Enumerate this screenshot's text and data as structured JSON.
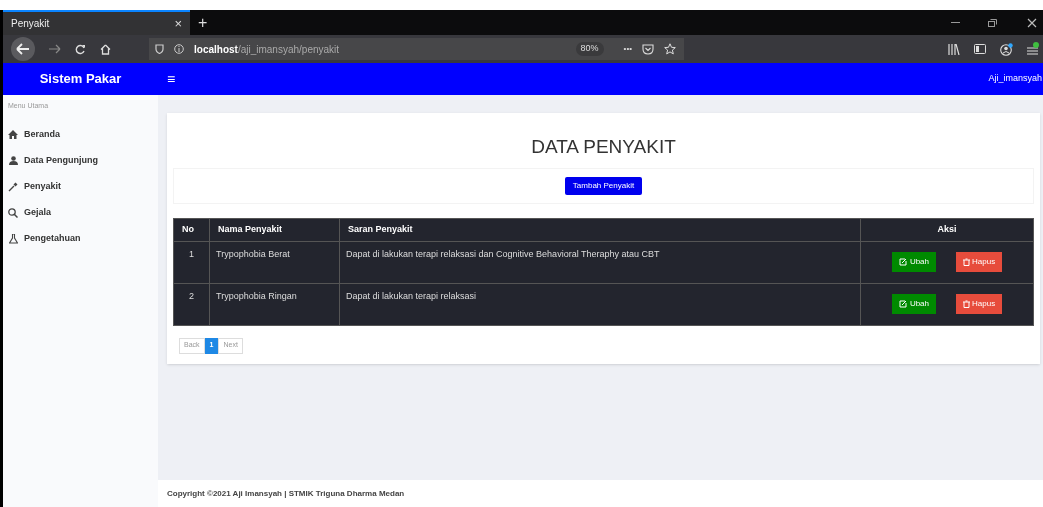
{
  "browser": {
    "tab_title": "Penyakit",
    "tab_close": "×",
    "new_tab": "+",
    "url": "**localhost**/aji_imansyah/penyakit",
    "zoom": "80%",
    "more": "•••"
  },
  "header": {
    "brand": "Sistem Pakar",
    "menu_toggle": "≡",
    "user": "Aji_imansyah"
  },
  "sidebar": {
    "heading": "Menu Utama",
    "items": [
      {
        "label": "Beranda"
      },
      {
        "label": "Data Pengunjung"
      },
      {
        "label": "Penyakit"
      },
      {
        "label": "Gejala"
      },
      {
        "label": "Pengetahuan"
      }
    ]
  },
  "page": {
    "title": "DATA PENYAKIT",
    "add_button": "Tambah Penyakit"
  },
  "table": {
    "columns": [
      "No",
      "Nama Penyakit",
      "Saran Penyakit",
      "Aksi"
    ],
    "rows": [
      {
        "no": "1",
        "name": "Trypophobia Berat",
        "advice": "Dapat di lakukan terapi relaksasi dan Cognitive Behavioral Theraphy atau CBT",
        "edit": "Ubah",
        "delete": "Hapus"
      },
      {
        "no": "2",
        "name": "Trypophobia Ringan",
        "advice": "Dapat di lakukan terapi relaksasi",
        "edit": "Ubah",
        "delete": "Hapus"
      }
    ]
  },
  "pagination": [
    {
      "label": "Back",
      "selected": false
    },
    {
      "label": "1",
      "selected": true
    },
    {
      "label": "Next",
      "selected": false
    }
  ],
  "footer": "Copyright ©2021 Aji Imansyah | STMIK Triguna Dharma Medan"
}
